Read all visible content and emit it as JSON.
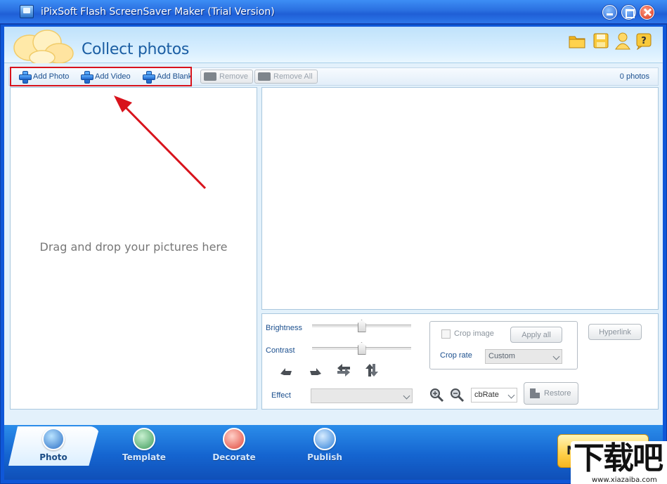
{
  "window": {
    "title": "iPixSoft Flash ScreenSaver Maker (Trial Version)"
  },
  "header": {
    "page_title": "Collect photos",
    "icons": [
      "folder-icon",
      "save-icon",
      "user-icon",
      "help-icon"
    ]
  },
  "toolbar": {
    "add_photo": "Add Photo",
    "add_video": "Add Video",
    "add_blank": "Add Blank",
    "remove": "Remove",
    "remove_all": "Remove All",
    "photo_count": "0 photos"
  },
  "photo_list": {
    "drop_hint": "Drag and drop your pictures here"
  },
  "adjust": {
    "brightness_label": "Brightness",
    "brightness_value": 0.5,
    "contrast_label": "Contrast",
    "contrast_value": 0.5,
    "effect_label": "Effect",
    "effect_value": "",
    "crop_image_label": "Crop image",
    "crop_image_checked": false,
    "apply_all": "Apply all",
    "crop_rate_label": "Crop rate",
    "crop_rate_value": "Custom",
    "hyperlink": "Hyperlink",
    "zoom_rate_value": "cbRate",
    "restore": "Restore"
  },
  "tabs": [
    {
      "label": "Photo",
      "active": true
    },
    {
      "label": "Template",
      "active": false
    },
    {
      "label": "Decorate",
      "active": false
    },
    {
      "label": "Publish",
      "active": false
    }
  ],
  "next_button": {
    "label": "N"
  },
  "watermark": {
    "main": "下载吧",
    "sub": "www.xiazaiba.com"
  },
  "colors": {
    "title_bar": "#2a6fe0",
    "accent": "#1b5ea3",
    "highlight_box": "#d8131c",
    "annotation_arrow": "#d8131c"
  }
}
